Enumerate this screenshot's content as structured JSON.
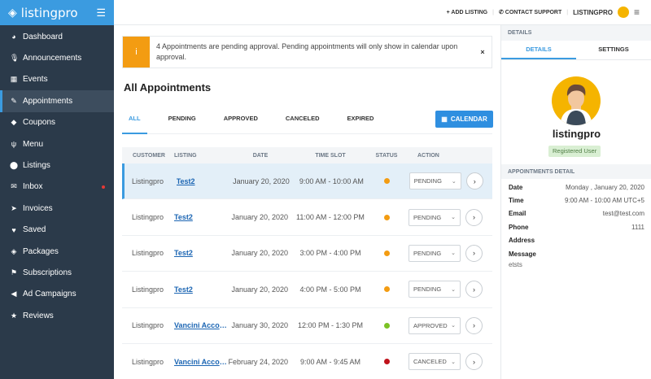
{
  "brand": {
    "name": "listingpro"
  },
  "sidebar": {
    "items": [
      {
        "label": "Dashboard",
        "icon": "dashboard-icon",
        "glyph": "◕"
      },
      {
        "label": "Announcements",
        "icon": "microphone-icon",
        "glyph": "🎙"
      },
      {
        "label": "Events",
        "icon": "calendar-icon",
        "glyph": "▦"
      },
      {
        "label": "Appointments",
        "icon": "edit-icon",
        "glyph": "✎",
        "active": true
      },
      {
        "label": "Coupons",
        "icon": "tag-icon",
        "glyph": "◆"
      },
      {
        "label": "Menu",
        "icon": "utensils-icon",
        "glyph": "ψ"
      },
      {
        "label": "Listings",
        "icon": "map-pin-icon",
        "glyph": "⬤"
      },
      {
        "label": "Inbox",
        "icon": "envelope-icon",
        "glyph": "✉",
        "badge_color": "#e53935"
      },
      {
        "label": "Invoices",
        "icon": "paper-plane-icon",
        "glyph": "➤"
      },
      {
        "label": "Saved",
        "icon": "heart-icon",
        "glyph": "♥"
      },
      {
        "label": "Packages",
        "icon": "cube-icon",
        "glyph": "◈"
      },
      {
        "label": "Subscriptions",
        "icon": "flag-icon",
        "glyph": "⚑"
      },
      {
        "label": "Ad Campaigns",
        "icon": "bullhorn-icon",
        "glyph": "◀"
      },
      {
        "label": "Reviews",
        "icon": "star-icon",
        "glyph": "★"
      }
    ]
  },
  "topbar": {
    "add_listing": "ADD LISTING",
    "contact_support": "CONTACT SUPPORT",
    "username": "LISTINGPRO"
  },
  "alert": {
    "text": "4 Appointments are pending approval. Pending appointments will only show in calendar upon approval.",
    "close": "×",
    "icon_glyph": "i"
  },
  "page": {
    "title": "All Appointments",
    "tabs": [
      "ALL",
      "PENDING",
      "APPROVED",
      "CANCELED",
      "EXPIRED"
    ],
    "calendar_button": "CALENDAR"
  },
  "table": {
    "headers": [
      "CUSTOMER",
      "LISTING",
      "DATE",
      "TIME SLOT",
      "STATUS",
      "ACTION"
    ],
    "rows": [
      {
        "customer": "Listingpro",
        "listing": "Test2",
        "date": "January 20, 2020",
        "time": "9:00 AM - 10:00 AM",
        "status_color": "#f39c12",
        "action": "PENDING",
        "active": true
      },
      {
        "customer": "Listingpro",
        "listing": "Test2",
        "date": "January 20, 2020",
        "time": "11:00 AM - 12:00 PM",
        "status_color": "#f39c12",
        "action": "PENDING"
      },
      {
        "customer": "Listingpro",
        "listing": "Test2",
        "date": "January 20, 2020",
        "time": "3:00 PM - 4:00 PM",
        "status_color": "#f39c12",
        "action": "PENDING"
      },
      {
        "customer": "Listingpro",
        "listing": "Test2",
        "date": "January 20, 2020",
        "time": "4:00 PM - 5:00 PM",
        "status_color": "#f39c12",
        "action": "PENDING"
      },
      {
        "customer": "Listingpro",
        "listing": "Vancini Accoun...",
        "date": "January 30, 2020",
        "time": "12:00 PM - 1:30 PM",
        "status_color": "#7cc225",
        "action": "APPROVED"
      },
      {
        "customer": "Listingpro",
        "listing": "Vancini Accoun...",
        "date": "February 24, 2020",
        "time": "9:00 AM - 9:45 AM",
        "status_color": "#c0121b",
        "action": "CANCELED"
      }
    ]
  },
  "details": {
    "header": "DETAILS",
    "tabs": [
      "DETAILS",
      "SETTINGS"
    ],
    "username": "listingpro",
    "role": "Registered User",
    "section_title": "APPOINTMENTS DETAIL",
    "fields": [
      {
        "key": "Date",
        "value": "Monday , January 20, 2020"
      },
      {
        "key": "Time",
        "value": "9:00 AM - 10:00 AM UTC+5"
      },
      {
        "key": "Email",
        "value": "test@test.com"
      },
      {
        "key": "Phone",
        "value": "1111"
      },
      {
        "key": "Address",
        "value": ""
      },
      {
        "key": "Message",
        "value": ""
      }
    ],
    "message_text": "etsts"
  },
  "colors": {
    "accent": "#3b9be0",
    "sidebar": "#2b3a4a",
    "warning": "#f39c12"
  }
}
